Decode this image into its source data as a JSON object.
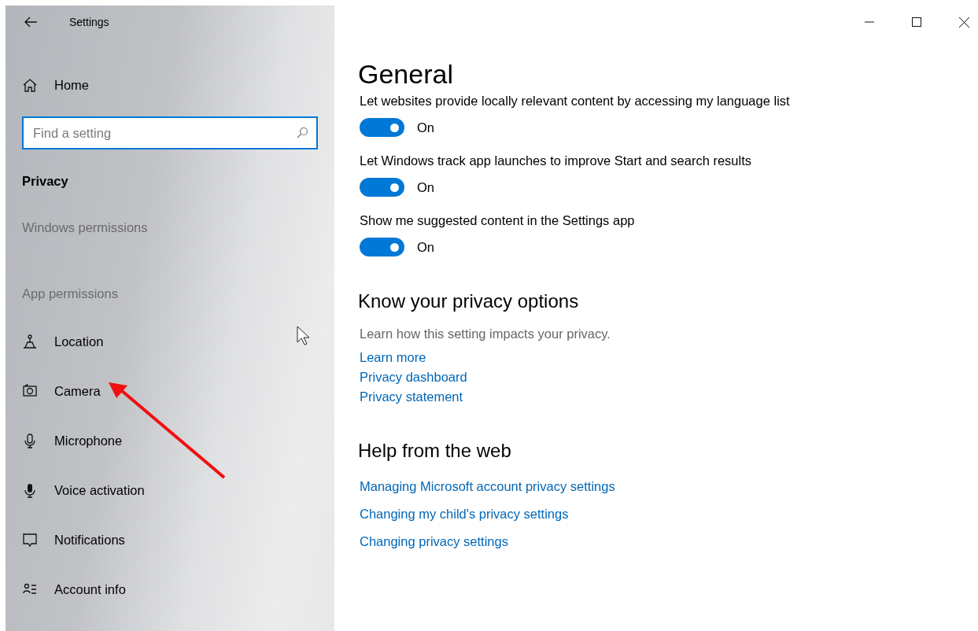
{
  "window": {
    "title": "Settings"
  },
  "sidebar": {
    "home": "Home",
    "search": {
      "placeholder": "Find a setting"
    },
    "section": "Privacy",
    "groups": [
      {
        "heading": "Windows permissions"
      },
      {
        "heading": "App permissions",
        "items": [
          {
            "label": "Location",
            "selected": false
          },
          {
            "label": "Camera",
            "selected": false
          },
          {
            "label": "Microphone",
            "selected": false
          },
          {
            "label": "Voice activation",
            "selected": false
          },
          {
            "label": "Notifications",
            "selected": false
          },
          {
            "label": "Account info",
            "selected": false
          }
        ]
      }
    ]
  },
  "main": {
    "heading": "General",
    "settings": [
      {
        "label": "Let websites provide locally relevant content by accessing my language list",
        "on": true,
        "state_text": "On"
      },
      {
        "label": "Let Windows track app launches to improve Start and search results",
        "on": true,
        "state_text": "On"
      },
      {
        "label": "Show me suggested content in the Settings app",
        "on": true,
        "state_text": "On"
      }
    ],
    "sections": [
      {
        "heading": "Know your privacy options",
        "description": "Learn how this setting impacts your privacy.",
        "links": [
          "Learn more",
          "Privacy dashboard",
          "Privacy statement"
        ]
      },
      {
        "heading": "Help from the web",
        "links": [
          "Managing Microsoft account privacy settings",
          "Changing my child's privacy settings",
          "Changing privacy settings"
        ]
      }
    ]
  }
}
